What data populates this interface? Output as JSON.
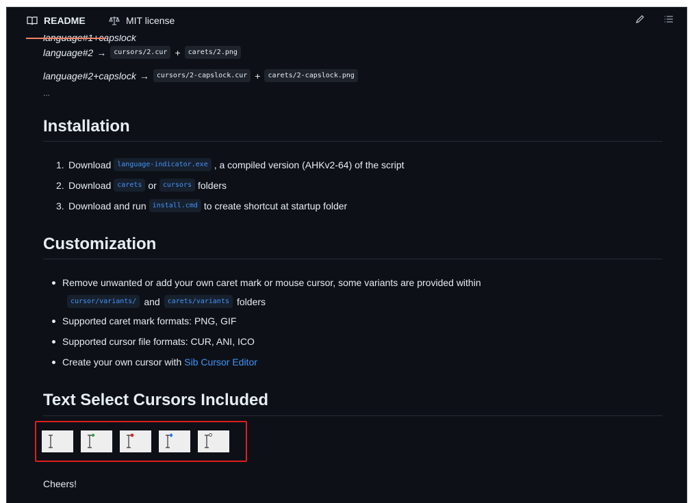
{
  "tabs": {
    "readme_label": "README",
    "license_label": "MIT license",
    "active": "README"
  },
  "toolbar": {
    "edit_icon": "pencil-icon",
    "toc_icon": "list-icon"
  },
  "mappings": [
    {
      "lang": "language#2",
      "arrow": "→",
      "cursor": "cursors/2.cur",
      "plus": "+",
      "caret": "carets/2.png"
    },
    {
      "lang": "language#2+capslock",
      "arrow": "→",
      "cursor": "cursors/2-capslock.cur",
      "plus": "+",
      "caret": "carets/2-capslock.png"
    }
  ],
  "ellipsis": "...",
  "installation": {
    "heading": "Installation",
    "steps": [
      {
        "num": "1.",
        "pre": "Download",
        "code": "language-indicator.exe",
        "post": ", a compiled version (AHKv2-64) of the script"
      },
      {
        "num": "2.",
        "pre": "Download",
        "code": "carets",
        "mid": "or",
        "code2": "cursors",
        "post": "folders"
      },
      {
        "num": "3.",
        "pre": "Download and run",
        "code": "install.cmd",
        "post": "to create shortcut at startup folder"
      }
    ]
  },
  "customization": {
    "heading": "Customization",
    "items": [
      {
        "text": "Remove unwanted or add your own caret mark or mouse cursor, some variants are provided within"
      },
      {
        "code": "cursor/variants/",
        "mid": "and",
        "code2": "carets/variants",
        "post": "folders"
      },
      {
        "text": "Supported caret mark formats: PNG, GIF"
      },
      {
        "text": "Supported cursor file formats: CUR, ANI, ICO"
      },
      {
        "pre": "Create your own cursor with",
        "link": "Sib Cursor Editor"
      }
    ]
  },
  "text_select": {
    "heading": "Text Select Cursors Included",
    "cursors": [
      {
        "name": "ibeam-plain-icon",
        "dot": ""
      },
      {
        "name": "ibeam-green-icon",
        "dot": "#2ea043"
      },
      {
        "name": "ibeam-red-icon",
        "dot": "#e5232b"
      },
      {
        "name": "ibeam-blue-icon",
        "dot": "#1f6feb"
      },
      {
        "name": "ibeam-ring-icon",
        "dot": "ring"
      }
    ],
    "highlight_color": "#e11d1d"
  },
  "cheers": "Cheers!",
  "colors": {
    "background": "#0d1117",
    "text": "#e6edf3",
    "link": "#4493f8",
    "tab_underline": "#f78166"
  }
}
